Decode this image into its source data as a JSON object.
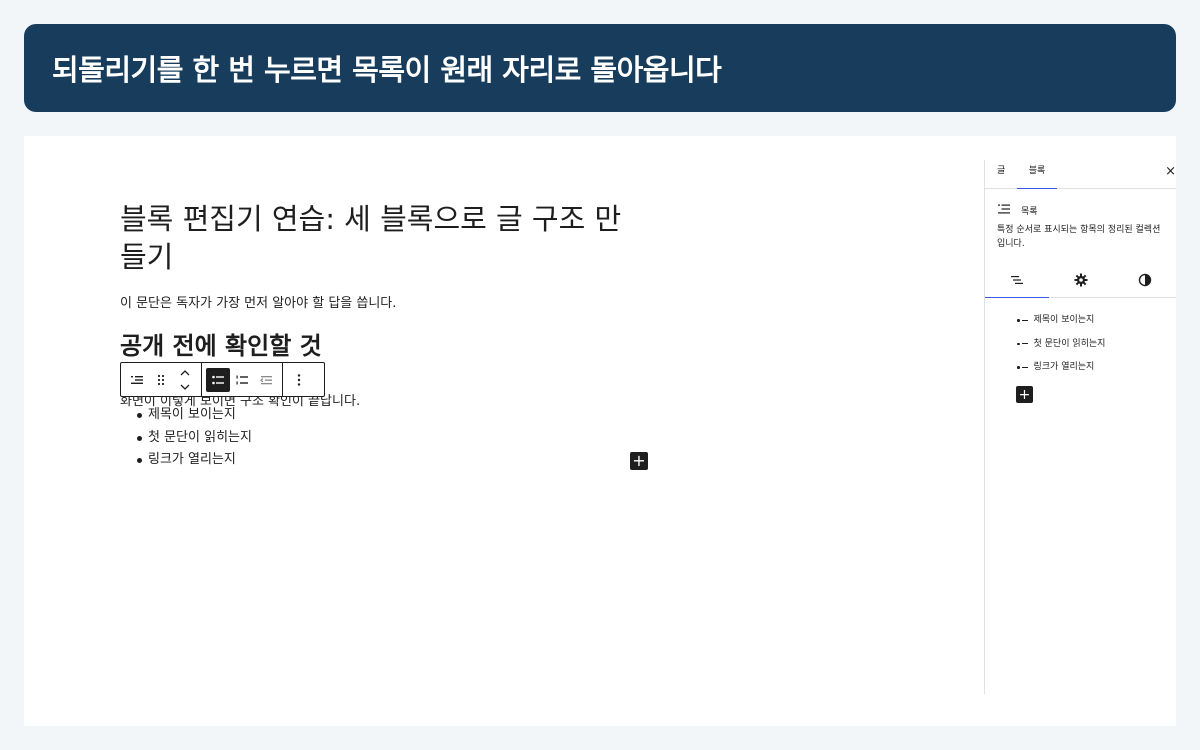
{
  "banner": {
    "title": "되돌리기를 한 번 누르면 목록이 원래 자리로 돌아옵니다"
  },
  "editor": {
    "post_title": "블록 편집기 연습: 세 블록으로 글 구조 만들기",
    "paragraph_1": "이 문단은 독자가 가장 먼저 알아야 할 답을 씁니다.",
    "heading_2": "공개 전에 확인할 것",
    "paragraph_2": "화면이 이렇게 보이면 구조 확인이 끝납니다.",
    "list_items": [
      "제목이 보이는지",
      "첫 문단이 읽히는지",
      "링크가 열리는지"
    ]
  },
  "toolbar": {
    "icons": [
      "list-icon",
      "drag-handle-icon",
      "move-up-icon",
      "move-down-icon",
      "unordered-list-icon",
      "ordered-list-icon",
      "outdent-icon",
      "more-options-icon"
    ],
    "active": "unordered-list-icon"
  },
  "sidebar": {
    "tab_post": "글",
    "tab_block": "블록",
    "close_label": "×",
    "block_name": "목록",
    "block_description": "특정 순서로 표시되는 항목의 정리된 컬렉션입니다.",
    "style_tabs": [
      "list-view-icon",
      "settings-gear-icon",
      "styles-contrast-icon"
    ],
    "outline_items": [
      "제목이 보이는지",
      "첫 문단이 읽히는지",
      "링크가 열리는지"
    ]
  },
  "colors": {
    "banner_bg": "#173c5c",
    "accent": "#3858e9",
    "text": "#1e1e1e"
  }
}
